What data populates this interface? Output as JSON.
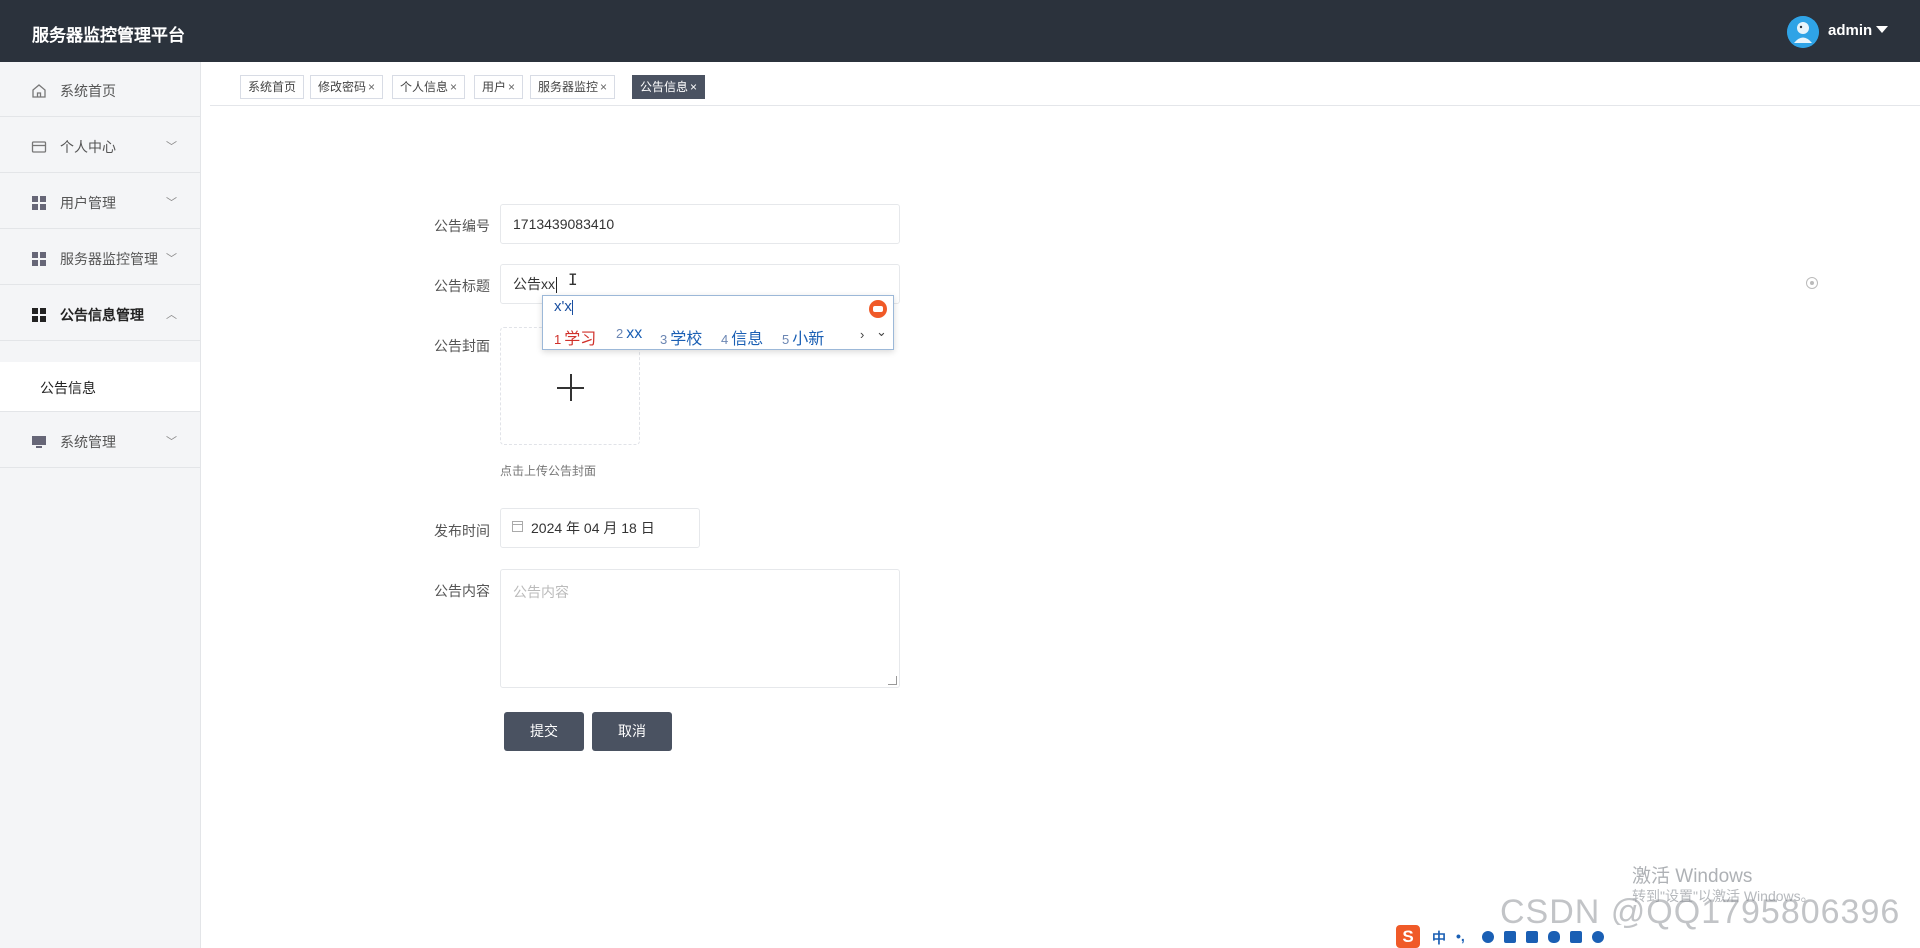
{
  "header": {
    "app_title": "服务器监控管理平台",
    "user_name": "admin"
  },
  "sidebar": {
    "items": [
      {
        "label": "系统首页",
        "icon": "home-icon",
        "has_chevron": false
      },
      {
        "label": "个人中心",
        "icon": "wallet-icon",
        "chevron": "﹀"
      },
      {
        "label": "用户管理",
        "icon": "grid-icon",
        "chevron": "﹀"
      },
      {
        "label": "服务器监控管理",
        "icon": "grid-icon",
        "chevron": "﹀"
      },
      {
        "label": "公告信息管理",
        "icon": "grid-icon",
        "chevron": "︿",
        "expanded": true
      },
      {
        "label": "系统管理",
        "icon": "monitor-icon",
        "chevron": "﹀"
      }
    ],
    "sub_items": [
      {
        "label": "公告信息",
        "parent": "公告信息管理"
      }
    ]
  },
  "tabs": [
    {
      "label": "系统首页",
      "closable": false
    },
    {
      "label": "修改密码",
      "closable": true
    },
    {
      "label": "个人信息",
      "closable": true
    },
    {
      "label": "用户",
      "closable": true
    },
    {
      "label": "服务器监控",
      "closable": true
    },
    {
      "label": "公告信息",
      "closable": true,
      "active": true
    }
  ],
  "tab_close_glyph": "×",
  "form": {
    "number": {
      "label": "公告编号",
      "value": "1713439083410"
    },
    "title": {
      "label": "公告标题",
      "value": "公告xx"
    },
    "cover": {
      "label": "公告封面",
      "tip": "点击上传公告封面"
    },
    "publish_time": {
      "label": "发布时间",
      "value": "2024 年 04 月 18 日"
    },
    "content": {
      "label": "公告内容",
      "placeholder": "公告内容",
      "value": ""
    },
    "submit_label": "提交",
    "cancel_label": "取消"
  },
  "ime_popup": {
    "composition": "x'x",
    "candidates": [
      {
        "num": "1",
        "text": "学习"
      },
      {
        "num": "2",
        "text": "xx"
      },
      {
        "num": "3",
        "text": "学校"
      },
      {
        "num": "4",
        "text": "信息"
      },
      {
        "num": "5",
        "text": "小新"
      }
    ],
    "next_glyph": "›",
    "expand_glyph": "⌄"
  },
  "overlays": {
    "activate_windows_line1": "激活 Windows",
    "activate_windows_line2": "转到\"设置\"以激活 Windows。",
    "csdn_watermark": "CSDN @QQ1795806396"
  },
  "ime_toolbar": {
    "logo": "S",
    "lang": "中",
    "punct": "•,"
  },
  "colors": {
    "header_bg": "#2b323c",
    "accent": "#4a5261",
    "sidebar_bg": "#f4f5f7",
    "ime_highlight": "#d0302a",
    "ime_text": "#1a5fb4"
  }
}
